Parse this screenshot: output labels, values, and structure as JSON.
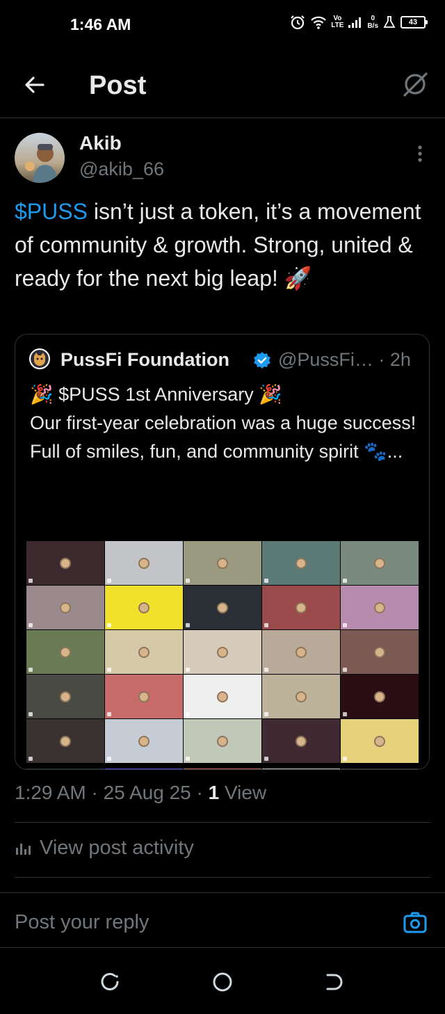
{
  "status": {
    "time": "1:46 AM",
    "volte": "Vo",
    "lte": "LTE",
    "netspeed_value": "0",
    "netspeed_unit": "B/s",
    "battery": "43"
  },
  "header": {
    "title": "Post",
    "back_icon": "arrow-left-icon",
    "grok_icon": "grok-icon"
  },
  "post": {
    "author_name": "Akib",
    "author_handle": "@akib_66",
    "text_cashtag": "$PUSS",
    "text_body": " isn’t just a token, it’s a movement of community & growth. Strong, united & ready for the next big leap! 🚀",
    "timestamp": "1:29 AM · 25 Aug 25 · ",
    "views_count": "1",
    "views_label": " View"
  },
  "quote": {
    "name": "PussFi Foundation",
    "handle_time": "@PussFi… · 2h",
    "line1": "🎉 $PUSS 1st Anniversary 🎉",
    "line2": "Our first-year celebration was a huge success!",
    "line3": "Full of smiles, fun, and community spirit 🐾...",
    "tile_colors": [
      "#3d2a2e",
      "#c3c4c8",
      "#9a9a80",
      "#5b7a76",
      "#7a8a7e",
      "#9a8a8e",
      "#f2e12a",
      "#2a2f35",
      "#9a4a4a",
      "#b88aae",
      "#6a7a55",
      "#d6c9a8",
      "#d6cbbb",
      "#b8a998",
      "#7a5a52",
      "#4a4a44",
      "#c66a6a",
      "#efefef",
      "#bdb39a",
      "#2a0e14",
      "#3a3230",
      "#c6ccd6",
      "#c2c8b8",
      "#3e2a30",
      "#e6d27a"
    ],
    "strip_colors": [
      "#233030",
      "#4a52d6",
      "#c26a5a",
      "#c2c8c8",
      "#3a3230"
    ]
  },
  "activity": {
    "label": "View post activity",
    "icon": "bar-chart-icon"
  },
  "reply": {
    "placeholder": "Post your reply",
    "camera_icon": "camera-icon"
  },
  "colors": {
    "accent": "#1d9bf0",
    "muted": "#71767b",
    "text": "#e7e9ea",
    "border": "#2f3336"
  }
}
